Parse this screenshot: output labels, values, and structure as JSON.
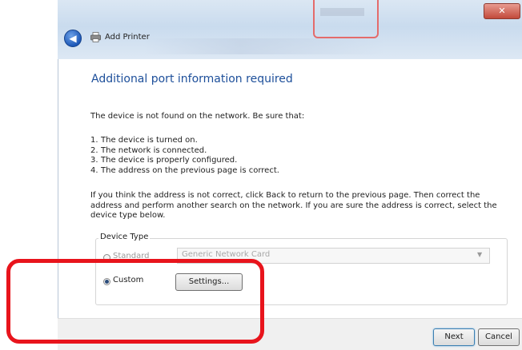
{
  "window": {
    "nav_title": "Add Printer",
    "close_label": "✕",
    "back_label": "◀"
  },
  "content": {
    "heading": "Additional port information required",
    "intro": "The device is not found on the network.  Be sure that:",
    "checklist": [
      {
        "num": "1.",
        "text": "The device is turned on."
      },
      {
        "num": "2.",
        "text": "The network is connected."
      },
      {
        "num": "3.",
        "text": "The device is properly configured."
      },
      {
        "num": "4.",
        "text": "The address on the previous page is correct."
      }
    ],
    "paragraph": "If you think the address is not correct, click Back to return to the previous page.  Then correct the address and perform another search on the network.  If you are sure the address is correct, select the device type below."
  },
  "device_type": {
    "group_label": "Device Type",
    "standard_label": "Standard",
    "standard_selected": false,
    "standard_value": "Generic Network Card",
    "custom_label": "Custom",
    "custom_selected": true,
    "settings_label": "Settings..."
  },
  "footer": {
    "next_label": "Next",
    "cancel_label": "Cancel"
  },
  "colors": {
    "heading": "#1d4f9a",
    "highlight": "#e8141c"
  }
}
